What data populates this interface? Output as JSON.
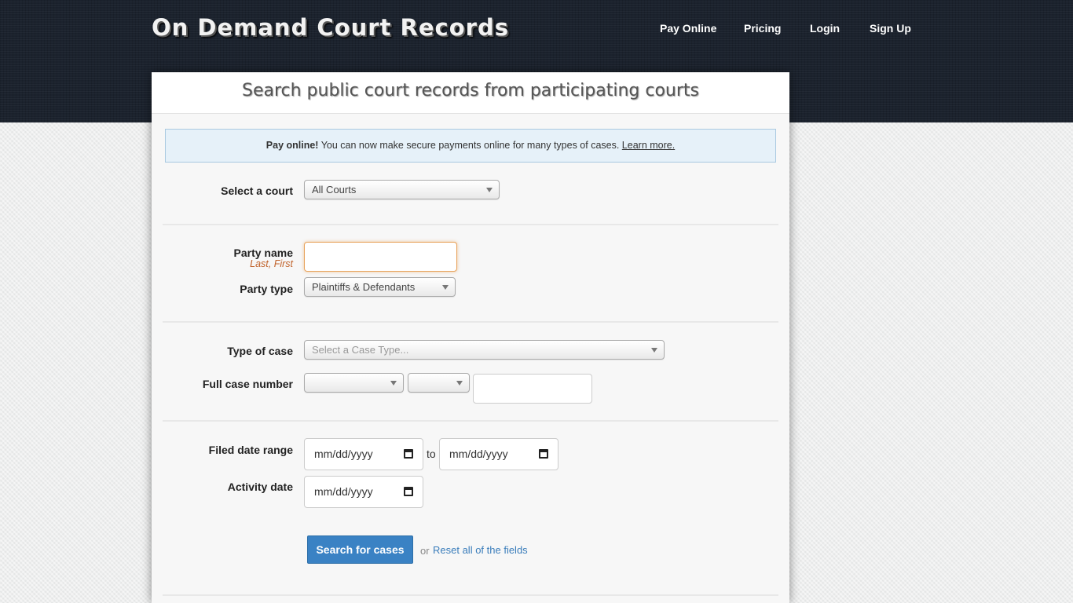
{
  "header": {
    "logo_text": "On Demand Court Records",
    "nav": [
      {
        "label": "Pay Online"
      },
      {
        "label": "Pricing"
      },
      {
        "label": "Login"
      },
      {
        "label": "Sign Up"
      }
    ]
  },
  "panel": {
    "title": "Search public court records from participating courts",
    "alert": {
      "strong": "Pay online!",
      "text": " You can now make secure payments online for many types of cases. ",
      "link": "Learn more."
    }
  },
  "form": {
    "court": {
      "label": "Select a court",
      "value": "All Courts"
    },
    "party_name": {
      "label": "Party name",
      "hint": "Last, First",
      "value": ""
    },
    "party_type": {
      "label": "Party type",
      "value": "Plaintiffs & Defendants"
    },
    "case_type": {
      "label": "Type of case",
      "placeholder": "Select a Case Type..."
    },
    "case_number": {
      "label": "Full case number",
      "part1": "",
      "part2": "",
      "part3": ""
    },
    "filed_date": {
      "label": "Filed date range",
      "from_placeholder": "mm/dd/yyyy",
      "separator": "to",
      "to_placeholder": "mm/dd/yyyy"
    },
    "activity_date": {
      "label": "Activity date",
      "placeholder": "mm/dd/yyyy"
    },
    "submit_label": "Search for cases",
    "or_text": "or",
    "reset_label": "Reset all of the fields"
  },
  "colors": {
    "header_bg": "#1b222d",
    "accent_blue": "#3a82c4",
    "focus_orange": "#e8a25a",
    "hint_orange": "#c0622a"
  }
}
